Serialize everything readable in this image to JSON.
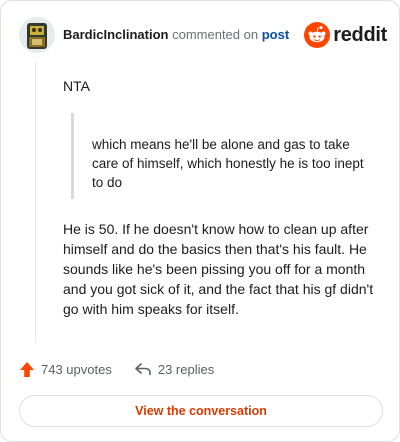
{
  "header": {
    "author": "BardicInclination",
    "commented_on": "commented on",
    "post_link": "post",
    "logo_text": "reddit"
  },
  "comment": {
    "intro": "NTA",
    "quote": "which means he'll be alone and gas to take care of himself, which honestly he is too inept to do",
    "body": "He is 50. If he doesn't know how to clean up after himself and do the basics then that's his fault. He sounds like he's been pissing you off for a month and you got sick of it, and the fact that his gf didn't go with him speaks for itself."
  },
  "actions": {
    "upvotes": "743 upvotes",
    "replies": "23 replies"
  },
  "cta": {
    "label": "View the conversation"
  },
  "icons": {
    "upvote": "upvote-arrow-icon",
    "reply": "reply-arrow-icon",
    "brand": "reddit-snoo-icon"
  },
  "colors": {
    "accent": "#ff4500",
    "link": "#0a4ea8",
    "cta_text": "#d93a00",
    "muted": "#6a7075"
  }
}
